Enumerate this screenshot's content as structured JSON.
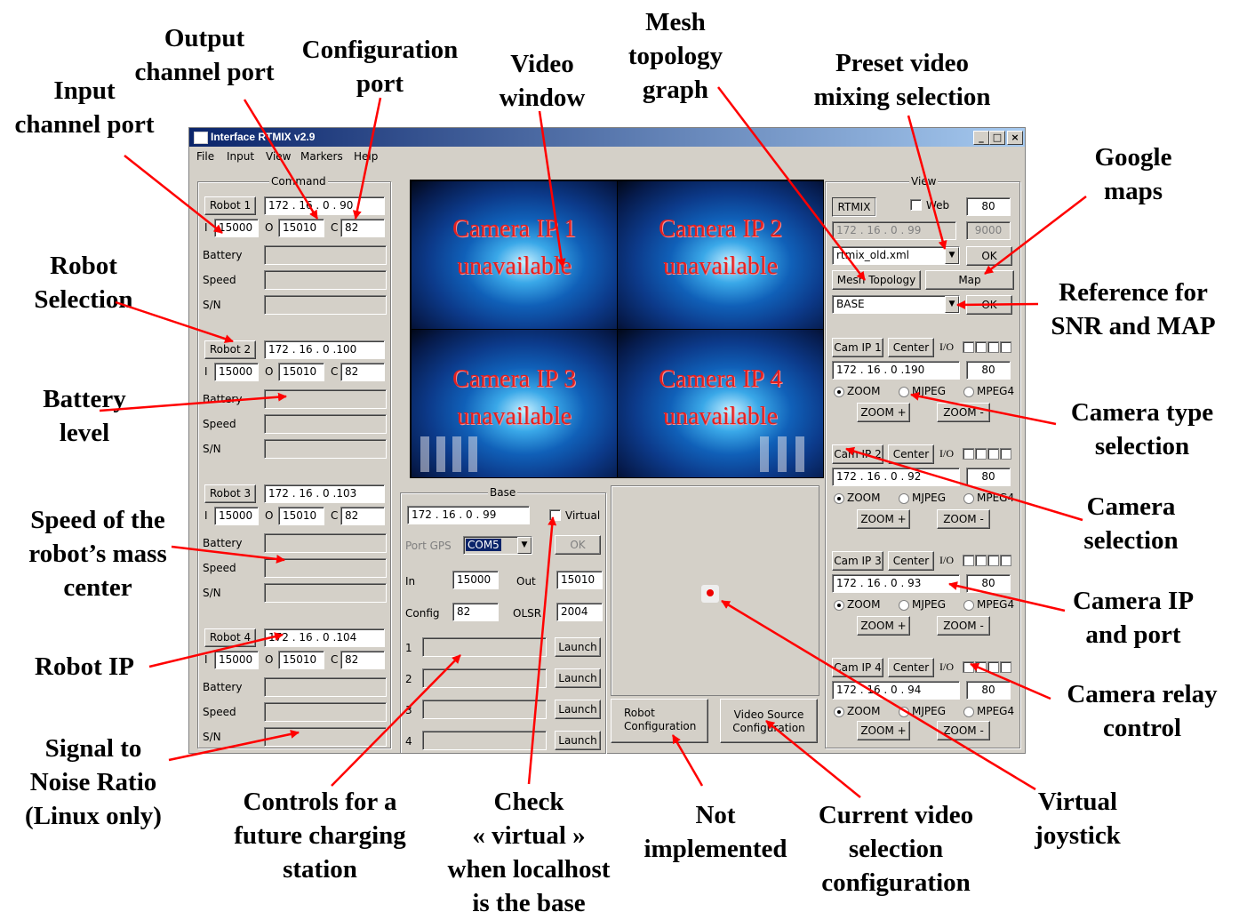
{
  "window": {
    "title": "Interface RTMIX v2.9",
    "controls": [
      "_",
      "□",
      "×"
    ],
    "menu": [
      "File",
      "Input",
      "View",
      "Markers",
      "Help"
    ]
  },
  "command": {
    "group_title": "Command",
    "field_labels": {
      "in": "I",
      "out": "O",
      "cfg": "C",
      "battery": "Battery",
      "speed": "Speed",
      "sn": "S/N"
    },
    "robots": [
      {
        "button": "Robot 1",
        "ip": "172 .  16  .  0   . 90",
        "in": "15000",
        "out": "15010",
        "cfg": "82"
      },
      {
        "button": "Robot 2",
        "ip": "172 .  16  .  0   .100",
        "in": "15000",
        "out": "15010",
        "cfg": "82"
      },
      {
        "button": "Robot 3",
        "ip": "172 .  16  .  0   .103",
        "in": "15000",
        "out": "15010",
        "cfg": "82"
      },
      {
        "button": "Robot 4",
        "ip": "172 .  16  .  0   .104",
        "in": "15000",
        "out": "15010",
        "cfg": "82"
      }
    ]
  },
  "video": {
    "cameras": [
      {
        "line1": "Camera IP 1",
        "line2": "unavailable"
      },
      {
        "line1": "Camera IP 2",
        "line2": "unavailable"
      },
      {
        "line1": "Camera IP 3",
        "line2": "unavailable"
      },
      {
        "line1": "Camera IP 4",
        "line2": "unavailable"
      }
    ]
  },
  "base": {
    "group_title": "Base",
    "ip": "172 .  16  .  0   . 99",
    "virtual_label": "Virtual",
    "port_gps_label": "Port GPS",
    "port_gps_value": "COM5",
    "ok_label": "OK",
    "in_label": "In",
    "in_value": "15000",
    "out_label": "Out",
    "out_value": "15010",
    "config_label": "Config",
    "config_value": "82",
    "olsr_label": "OLSR",
    "olsr_value": "2004",
    "launch_rows": [
      "1",
      "2",
      "3",
      "4"
    ],
    "launch_label": "Launch"
  },
  "bottom_buttons": {
    "robot_config": "Robot\nConfiguration",
    "video_source_config": "Video Source\nConfiguration"
  },
  "view": {
    "group_title": "View",
    "rtmix_button": "RTMIX",
    "web_label": "Web",
    "port": "80",
    "ip": "172 .  16  .  0   . 99",
    "port2": "9000",
    "preset_file": "rtmix_old.xml",
    "ok_label": "OK",
    "mesh_button": "Mesh Topology",
    "map_button": "Map",
    "reference": "BASE",
    "cameras": [
      {
        "button": "Cam IP 1",
        "ip": "172 .  16  .  0   .190",
        "port": "80",
        "selected": "ZOOM"
      },
      {
        "button": "Cam IP 2",
        "ip": "172 .  16  .  0   . 92",
        "port": "80",
        "selected": "ZOOM"
      },
      {
        "button": "Cam IP 3",
        "ip": "172 .  16  .  0   . 93",
        "port": "80",
        "selected": "ZOOM"
      },
      {
        "button": "Cam IP 4",
        "ip": "172 .  16  .  0   . 94",
        "port": "80",
        "selected": "ZOOM"
      }
    ],
    "center_label": "Center",
    "io_label": "I/O",
    "radio_labels": [
      "ZOOM",
      "MJPEG",
      "MPEG4"
    ],
    "zoom_plus": "ZOOM +",
    "zoom_minus": "ZOOM -"
  },
  "annotations": {
    "input_channel_port": "Input\nchannel port",
    "output_channel_port": "Output\nchannel port",
    "configuration_port": "Configuration\nport",
    "video_window": "Video\nwindow",
    "mesh_topology_graph": "Mesh\ntopology\ngraph",
    "preset_video_mixing": "Preset video\nmixing selection",
    "google_maps": "Google\nmaps",
    "robot_selection": "Robot\nSelection",
    "reference_snr_map": "Reference for\nSNR and MAP",
    "battery_level": "Battery\nlevel",
    "camera_type_selection": "Camera type\nselection",
    "speed_mass_center": "Speed of the\nrobot’s mass\ncenter",
    "camera_selection": "Camera\nselection",
    "camera_ip_port": "Camera IP\nand port",
    "robot_ip": "Robot IP",
    "camera_relay_control": "Camera relay\ncontrol",
    "snr_linux": "Signal to\nNoise Ratio\n(Linux only)",
    "charging_station": "Controls for a\nfuture charging\nstation",
    "check_virtual": "Check\n« virtual »\nwhen localhost\nis the base",
    "not_implemented": "Not\nimplemented",
    "current_video_config": "Current video\nselection\nconfiguration",
    "virtual_joystick": "Virtual\njoystick"
  },
  "colors": {
    "arrow": "#ff0000",
    "title_bar": "#0a246a",
    "window_bg": "#d4d0c8",
    "camera_text": "#e32020"
  }
}
